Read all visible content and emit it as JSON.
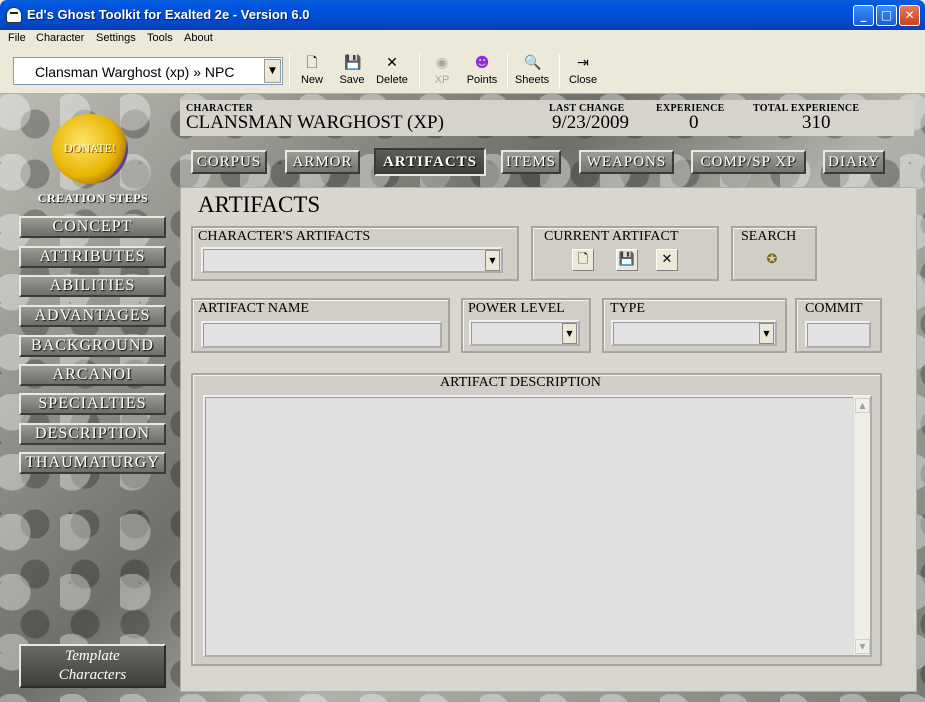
{
  "window": {
    "title": "Ed's Ghost Toolkit for Exalted 2e - Version 6.0"
  },
  "menu": [
    "File",
    "Character",
    "Settings",
    "Tools",
    "About"
  ],
  "toolbar": {
    "character_select": "Clansman Warghost (xp) » NPC",
    "buttons": [
      {
        "label": "New",
        "icon": "new-document-icon"
      },
      {
        "label": "Save",
        "icon": "floppy-disk-icon"
      },
      {
        "label": "Delete",
        "icon": "delete-x-icon"
      },
      {
        "label": "XP",
        "icon": "xp-icon",
        "disabled": true
      },
      {
        "label": "Points",
        "icon": "points-icon"
      },
      {
        "label": "Sheets",
        "icon": "sheets-icon"
      },
      {
        "label": "Close",
        "icon": "exit-door-icon"
      }
    ]
  },
  "sidebar": {
    "donate": "DONATE!",
    "creation_label": "CREATION STEPS",
    "steps": [
      "CONCEPT",
      "ATTRIBUTES",
      "ABILITIES",
      "ADVANTAGES",
      "BACKGROUND",
      "ARCANOI",
      "SPECIALTIES",
      "DESCRIPTION",
      "THAUMATURGY"
    ],
    "template": [
      "Template",
      "Characters"
    ]
  },
  "header": {
    "character_label": "CHARACTER",
    "character_value": "CLANSMAN WARGHOST (XP)",
    "last_change_label": "LAST CHANGE",
    "last_change_value": "9/23/2009",
    "experience_label": "EXPERIENCE",
    "experience_value": "0",
    "total_experience_label": "TOTAL EXPERIENCE",
    "total_experience_value": "310"
  },
  "tabs": [
    "CORPUS",
    "ARMOR",
    "ARTIFACTS",
    "ITEMS",
    "WEAPONS",
    "COMP/SP XP",
    "DIARY"
  ],
  "active_tab": "ARTIFACTS",
  "artifacts": {
    "section_title": "ARTIFACTS",
    "characters_artifacts_label": "CHARACTER'S ARTIFACTS",
    "characters_artifacts_value": "",
    "current_artifact_label": "CURRENT ARTIFACT",
    "search_label": "SEARCH",
    "name_label": "ARTIFACT NAME",
    "name_value": "",
    "power_level_label": "POWER LEVEL",
    "power_level_value": "",
    "type_label": "TYPE",
    "type_value": "",
    "commit_label": "COMMIT",
    "commit_value": "",
    "description_label": "ARTIFACT DESCRIPTION",
    "description_value": ""
  }
}
